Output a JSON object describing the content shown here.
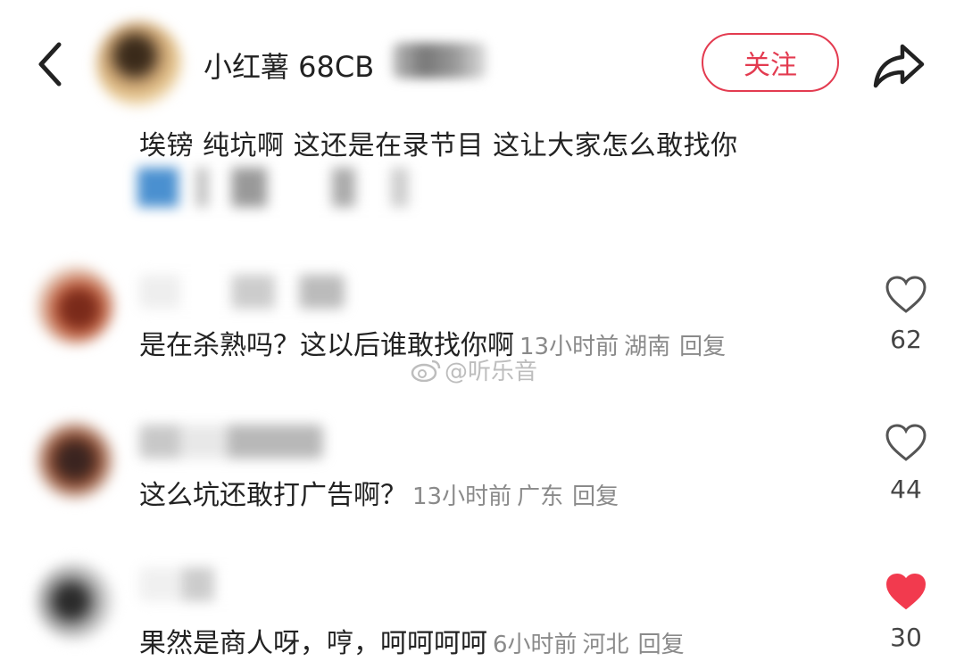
{
  "header": {
    "username": "小红薯 68CB",
    "follow_label": "关注"
  },
  "post": {
    "text": "埃镑 纯坑啊 这还是在录节目 这让大家怎么敢找你"
  },
  "comments": [
    {
      "text": "是在杀熟吗？这以后谁敢找你啊",
      "time": "13小时前",
      "location": "湖南",
      "reply_label": "回复",
      "likes": "62",
      "liked": false
    },
    {
      "text": "这么坑还敢打广告啊？",
      "time": "13小时前",
      "location": "广东",
      "reply_label": "回复",
      "likes": "44",
      "liked": false
    },
    {
      "text": "果然是商人呀，哼，呵呵呵呵",
      "time": "6小时前",
      "location": "河北",
      "reply_label": "回复",
      "likes": "30",
      "liked": true
    }
  ],
  "watermark": {
    "text": "@听乐音"
  },
  "colors": {
    "accent": "#e33b50",
    "meta": "#8a8a8a",
    "like_active": "#f23a4e"
  },
  "icons": [
    "back-arrow-icon",
    "share-icon",
    "heart-outline-icon",
    "heart-filled-icon",
    "weibo-icon"
  ]
}
